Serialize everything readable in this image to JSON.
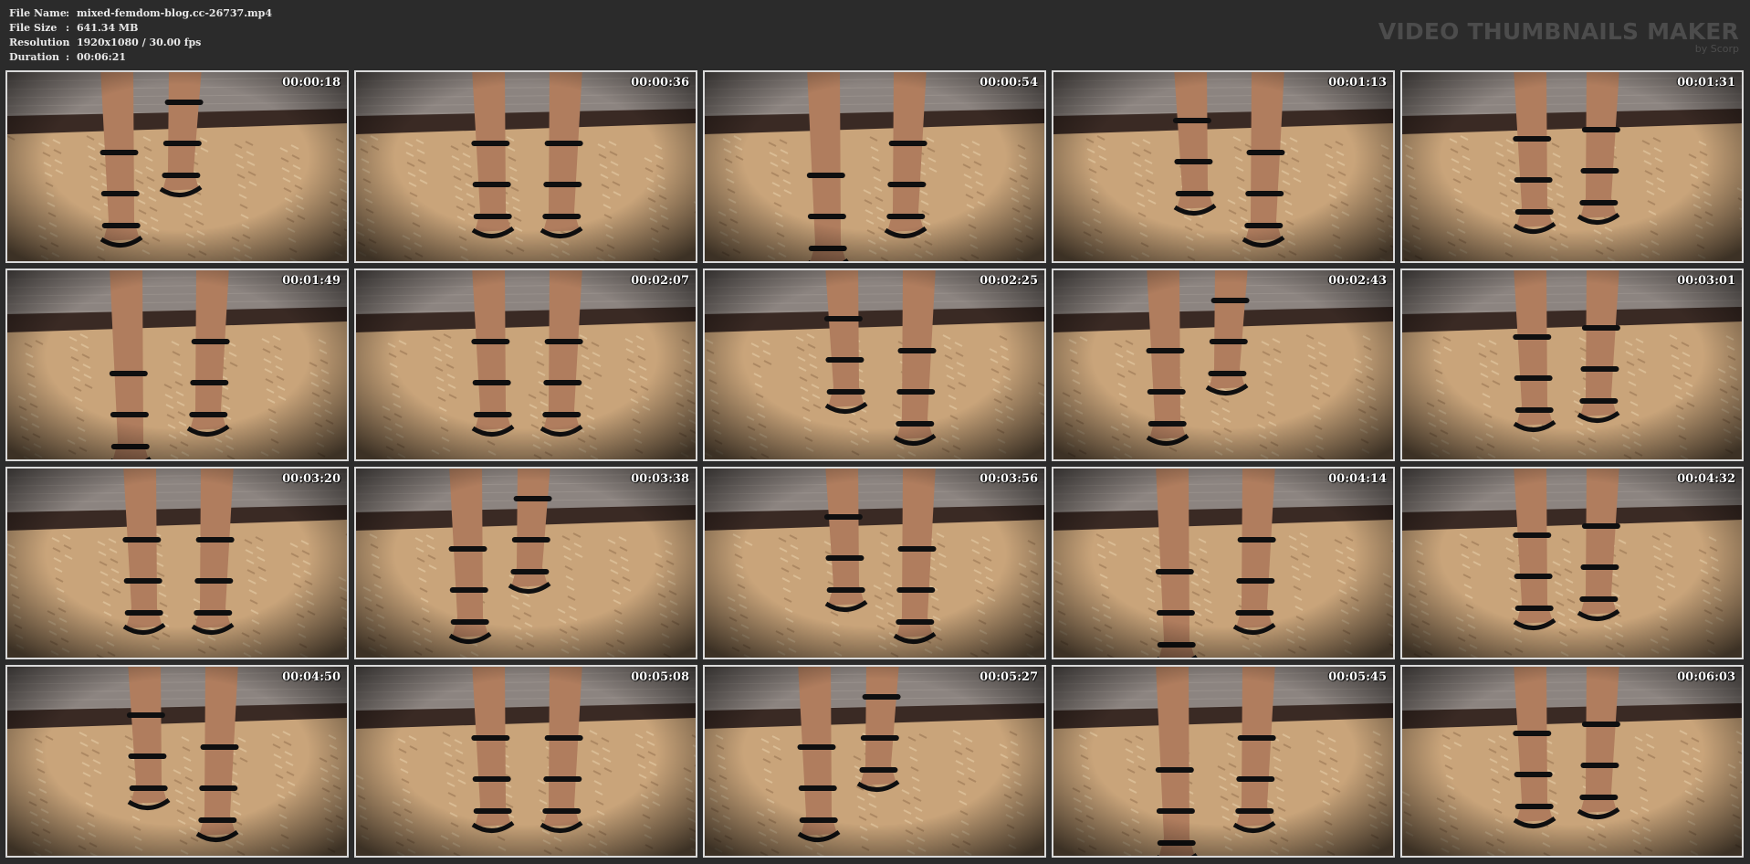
{
  "header": {
    "meta": [
      {
        "key": "File Name",
        "sep": ":",
        "value": "mixed-femdom-blog.cc-26737.mp4"
      },
      {
        "key": "File Size",
        "sep": ":",
        "value": "641.34 MB"
      },
      {
        "key": "Resolution",
        "sep": ":",
        "value": "1920x1080 / 30.00 fps"
      },
      {
        "key": "Duration",
        "sep": ":",
        "value": "00:06:21"
      }
    ],
    "brand_title": "VIDEO THUMBNAILS MAKER",
    "brand_sub": "by Scorp"
  },
  "thumbnails": [
    {
      "time": "00:00:18",
      "variant": 0
    },
    {
      "time": "00:00:36",
      "variant": 1
    },
    {
      "time": "00:00:54",
      "variant": 2
    },
    {
      "time": "00:01:13",
      "variant": 3
    },
    {
      "time": "00:01:31",
      "variant": 4
    },
    {
      "time": "00:01:49",
      "variant": 2
    },
    {
      "time": "00:02:07",
      "variant": 1
    },
    {
      "time": "00:02:25",
      "variant": 3
    },
    {
      "time": "00:02:43",
      "variant": 0
    },
    {
      "time": "00:03:01",
      "variant": 4
    },
    {
      "time": "00:03:20",
      "variant": 1
    },
    {
      "time": "00:03:38",
      "variant": 0
    },
    {
      "time": "00:03:56",
      "variant": 3
    },
    {
      "time": "00:04:14",
      "variant": 2
    },
    {
      "time": "00:04:32",
      "variant": 4
    },
    {
      "time": "00:04:50",
      "variant": 3
    },
    {
      "time": "00:05:08",
      "variant": 1
    },
    {
      "time": "00:05:27",
      "variant": 0
    },
    {
      "time": "00:05:45",
      "variant": 2
    },
    {
      "time": "00:06:03",
      "variant": 4
    }
  ],
  "colors": {
    "background": "#2b2b2b",
    "frame_border": "#d9d9d9",
    "wall": "#8c8480",
    "floor_strip": "#3a2a24",
    "rug": "#c9a47a",
    "rug_shade": "#a07d58",
    "skin": "#b07d5e",
    "strap": "#0f0f10"
  }
}
